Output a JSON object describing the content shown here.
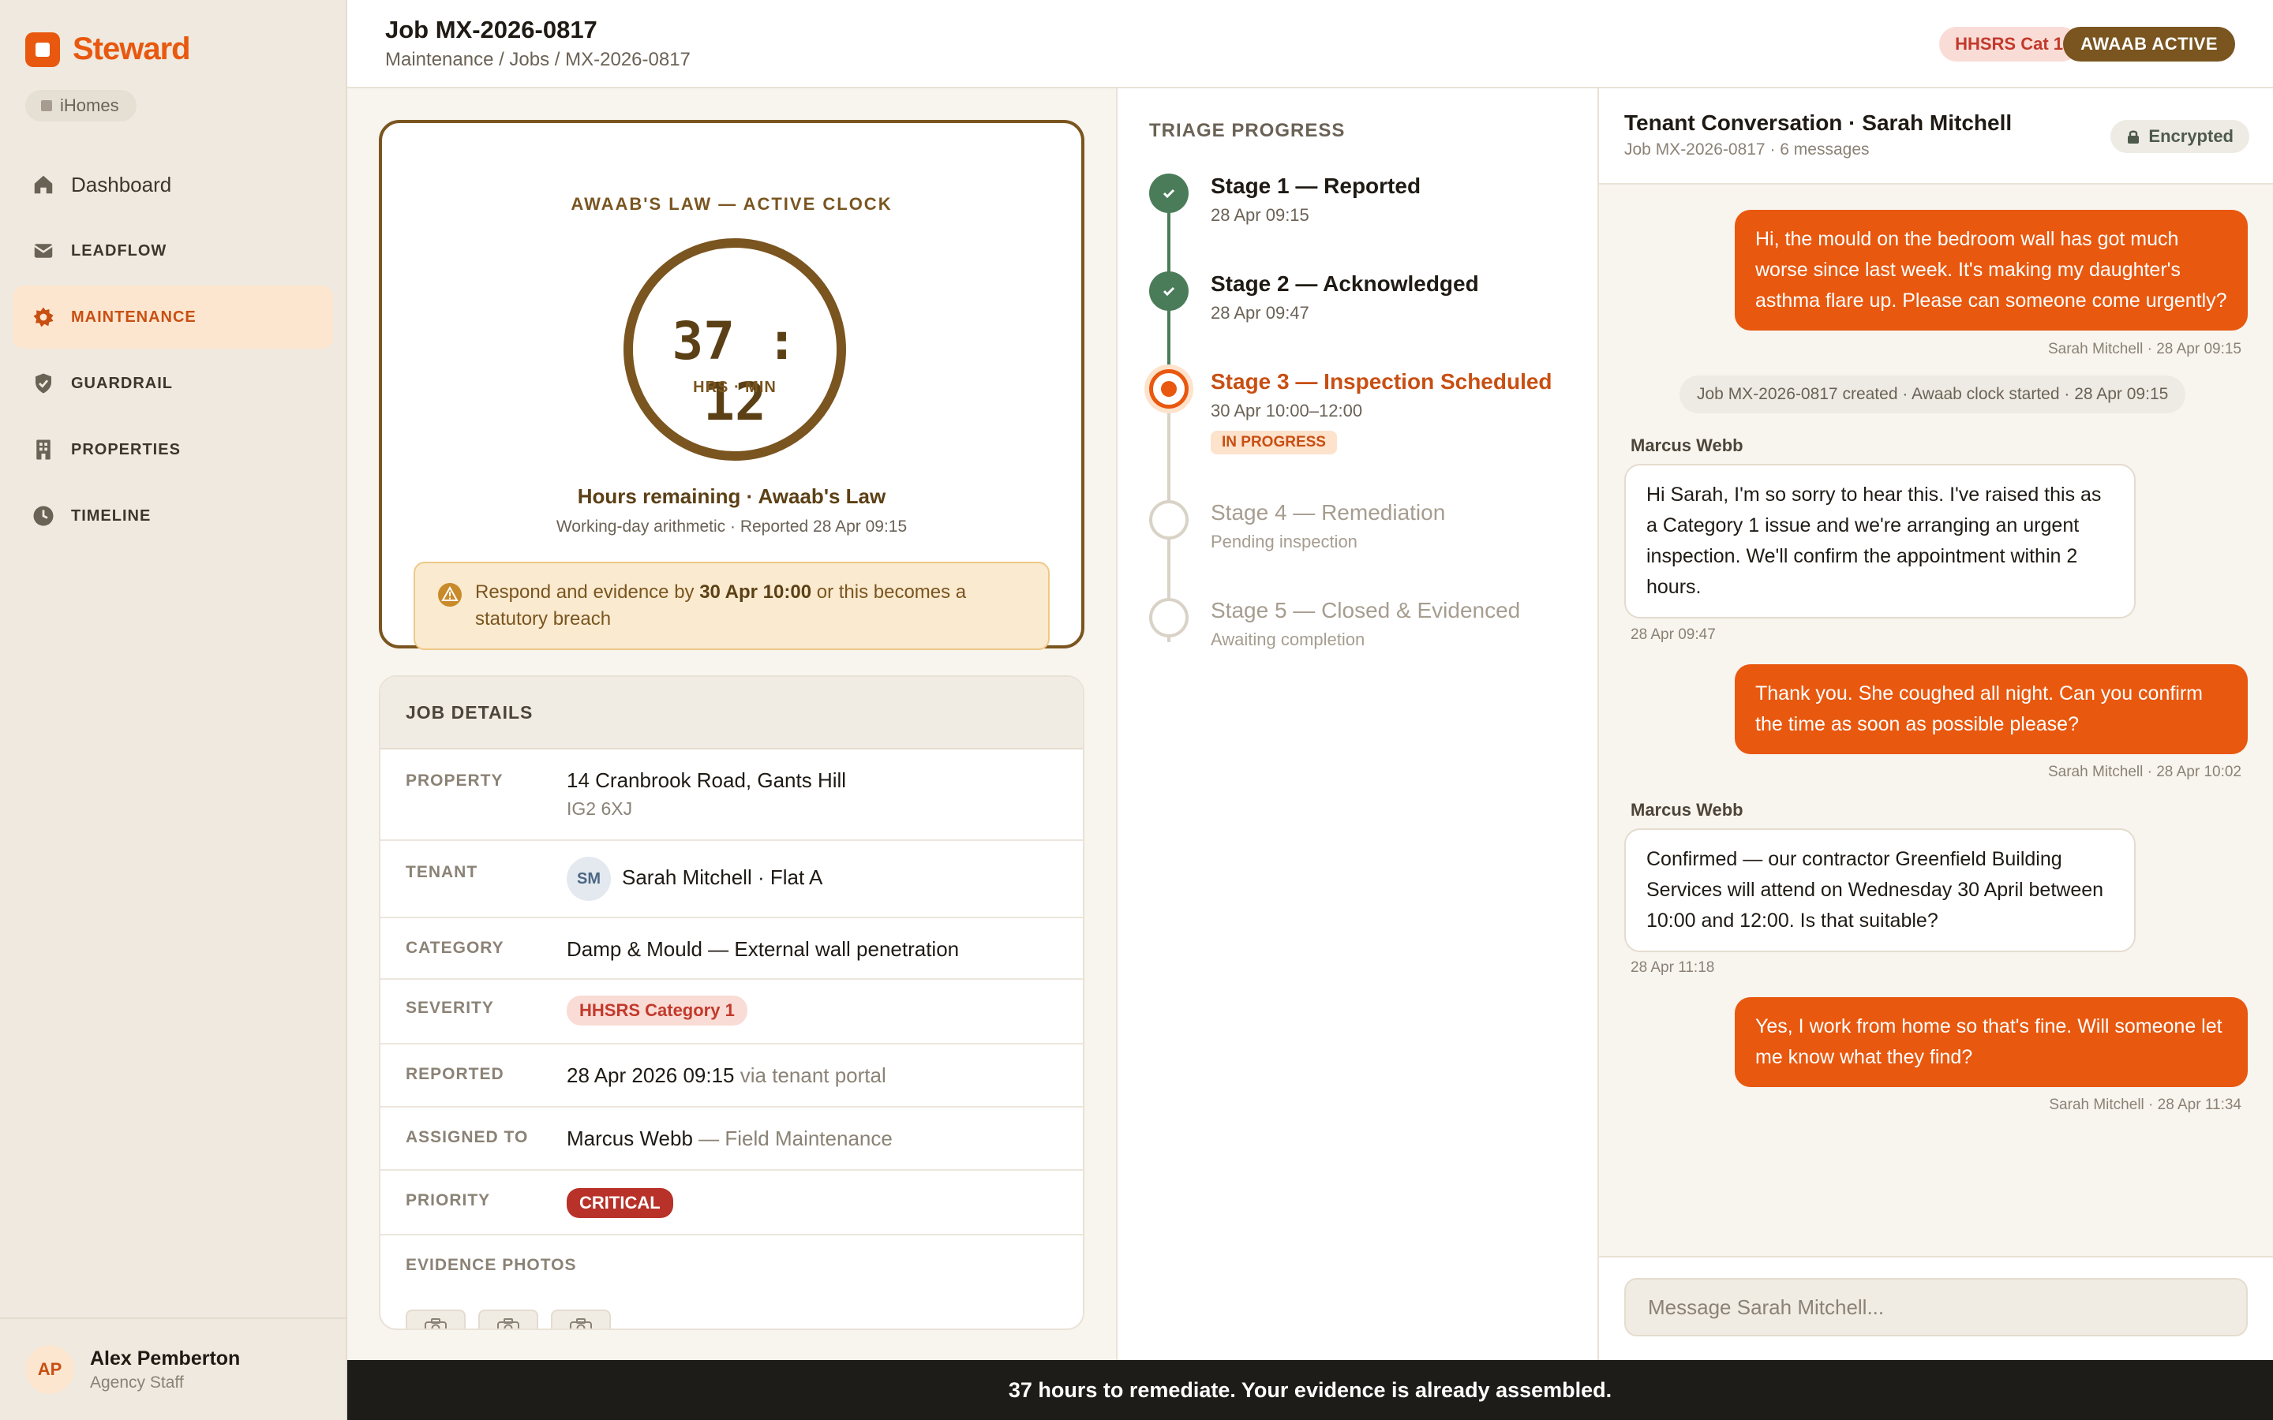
{
  "app": {
    "name": "Steward",
    "org": "iHomes"
  },
  "sidebar": {
    "items": [
      {
        "label": "Dashboard",
        "icon": "home-icon"
      },
      {
        "label": "LEADFLOW",
        "icon": "inbox-icon"
      },
      {
        "label": "MAINTENANCE",
        "icon": "gear-icon",
        "active": true
      },
      {
        "label": "GUARDRAIL",
        "icon": "shield-check-icon"
      },
      {
        "label": "PROPERTIES",
        "icon": "building-icon"
      },
      {
        "label": "TIMELINE",
        "icon": "clock-icon"
      }
    ],
    "user": {
      "initials": "AP",
      "name": "Alex Pemberton",
      "role": "Agency Staff"
    }
  },
  "header": {
    "title": "Job MX-2026-0817",
    "breadcrumb": "Maintenance / Jobs / MX-2026-0817",
    "badge_category": "HHSRS Cat 1",
    "badge_awaab": "AWAAB ACTIVE"
  },
  "clock": {
    "heading": "AWAAB'S LAW — ACTIVE CLOCK",
    "time": "37 : 12",
    "unit": "HRS · MIN",
    "label": "Hours remaining · Awaab's Law",
    "sub": "Working-day arithmetic · Reported 28 Apr 09:15",
    "warning_prefix": "Respond and evidence by ",
    "warning_deadline": "30 Apr 10:00",
    "warning_suffix": " or this becomes a statutory breach"
  },
  "details": {
    "heading": "JOB DETAILS",
    "property_label": "PROPERTY",
    "property_line1": "14 Cranbrook Road, Gants Hill",
    "property_line2": "IG2 6XJ",
    "tenant_label": "TENANT",
    "tenant_initials": "SM",
    "tenant_value": "Sarah Mitchell · Flat A",
    "category_label": "CATEGORY",
    "category_value": "Damp & Mould — External wall penetration",
    "severity_label": "SEVERITY",
    "severity_value": "HHSRS Category 1",
    "reported_label": "REPORTED",
    "reported_value": "28 Apr 2026 09:15",
    "reported_via": " via tenant portal",
    "assigned_label": "ASSIGNED TO",
    "assigned_value": "Marcus Webb",
    "assigned_team": " — Field Maintenance",
    "priority_label": "PRIORITY",
    "priority_value": "CRITICAL",
    "evidence_label": "EVIDENCE PHOTOS"
  },
  "triage": {
    "heading": "TRIAGE PROGRESS",
    "stages": [
      {
        "title": "Stage 1 — Reported",
        "date": "28 Apr 09:15",
        "status": "done"
      },
      {
        "title": "Stage 2 — Acknowledged",
        "date": "28 Apr 09:47",
        "status": "done"
      },
      {
        "title": "Stage 3 — Inspection Scheduled",
        "date": "30 Apr 10:00–12:00",
        "status": "current",
        "pill": "IN PROGRESS"
      },
      {
        "title": "Stage 4 — Remediation",
        "date": "Pending inspection",
        "status": "pending"
      },
      {
        "title": "Stage 5 — Closed & Evidenced",
        "date": "Awaiting completion",
        "status": "pending"
      }
    ]
  },
  "chat": {
    "title": "Tenant Conversation · Sarah Mitchell",
    "sub": "Job MX-2026-0817 · 6 messages",
    "encrypted": "Encrypted",
    "messages": [
      {
        "text": "Hi, the mould on the bedroom wall has got much worse since last week. It's making my daughter's asthma flare up. Please can someone come urgently?",
        "meta": "Sarah Mitchell · 28 Apr 09:15"
      },
      {
        "system": "Job MX-2026-0817 created · Awaab clock started · 28 Apr 09:15"
      },
      {
        "sender": "Marcus Webb",
        "text": "Hi Sarah, I'm so sorry to hear this. I've raised this as a Category 1 issue and we're arranging an urgent inspection. We'll confirm the appointment within 2 hours.",
        "meta": "28 Apr 09:47"
      },
      {
        "text": "Thank you. She coughed all night. Can you confirm the time as soon as possible please?",
        "meta": "Sarah Mitchell · 28 Apr 10:02"
      },
      {
        "sender": "Marcus Webb",
        "text": "Confirmed — our contractor Greenfield Building Services will attend on Wednesday 30 April between 10:00 and 12:00. Is that suitable?",
        "meta": "28 Apr 11:18"
      },
      {
        "text": "Yes, I work from home so that's fine. Will someone let me know what they find?",
        "meta": "Sarah Mitchell · 28 Apr 11:34"
      }
    ],
    "composer_placeholder": "Message Sarah Mitchell..."
  },
  "banner": "37 hours to remediate. Your evidence is already assembled.",
  "colors": {
    "brand": "#e8580f",
    "awaab": "#7a5520",
    "done": "#4a7c59",
    "critical": "#b8322a"
  }
}
